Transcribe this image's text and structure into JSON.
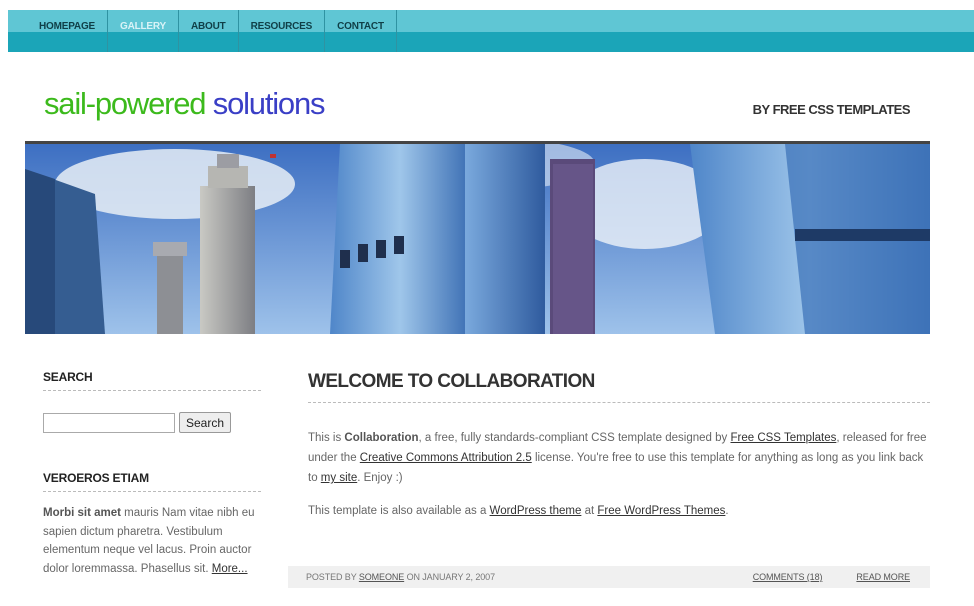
{
  "nav": {
    "items": [
      {
        "label": "HOMEPAGE"
      },
      {
        "label": "GALLERY"
      },
      {
        "label": "ABOUT"
      },
      {
        "label": "RESOURCES"
      },
      {
        "label": "CONTACT"
      }
    ],
    "active": "GALLERY"
  },
  "header": {
    "logo_part1": "sail-powered ",
    "logo_part2": "solutions",
    "tagline": "BY FREE CSS TEMPLATES"
  },
  "banner": {
    "image": "city-skyscrapers-photo"
  },
  "sidebar": {
    "search_title": "SEARCH",
    "search_input_value": "",
    "search_button": "Search",
    "block_title": "VEROEROS ETIAM",
    "block_bold": "Morbi sit amet",
    "block_text": " mauris Nam vitae nibh eu sapien dictum pharetra. Vestibulum elementum neque vel lacus. Proin auctor dolor loremmassa. Phasellus sit. ",
    "block_more": "More..."
  },
  "main": {
    "title": "WELCOME TO COLLABORATION",
    "p1_a": "This is ",
    "p1_b": "Collaboration",
    "p1_c": ", a free, fully standards-compliant CSS template designed by ",
    "p1_link1": "Free CSS Templates",
    "p1_d": ", released for free under the ",
    "p1_link2": "Creative Commons Attribution 2.5",
    "p1_e": " license. You're free to use this template for anything as long as you link back to ",
    "p1_link3": "my site",
    "p1_f": ". Enjoy :)",
    "p2_a": "This template is also available as a ",
    "p2_link1": "WordPress theme",
    "p2_b": " at ",
    "p2_link2": "Free WordPress Themes",
    "p2_c": "."
  },
  "meta": {
    "posted_by": "POSTED BY ",
    "author": "SOMEONE",
    "date_text": " ON JANUARY 2, 2007",
    "comments": "COMMENTS (18)",
    "read_more": "READ MORE"
  },
  "colors": {
    "nav_bg": "#1ba5b8",
    "logo_green": "#3cba1c",
    "logo_blue": "#3a3fc6"
  }
}
